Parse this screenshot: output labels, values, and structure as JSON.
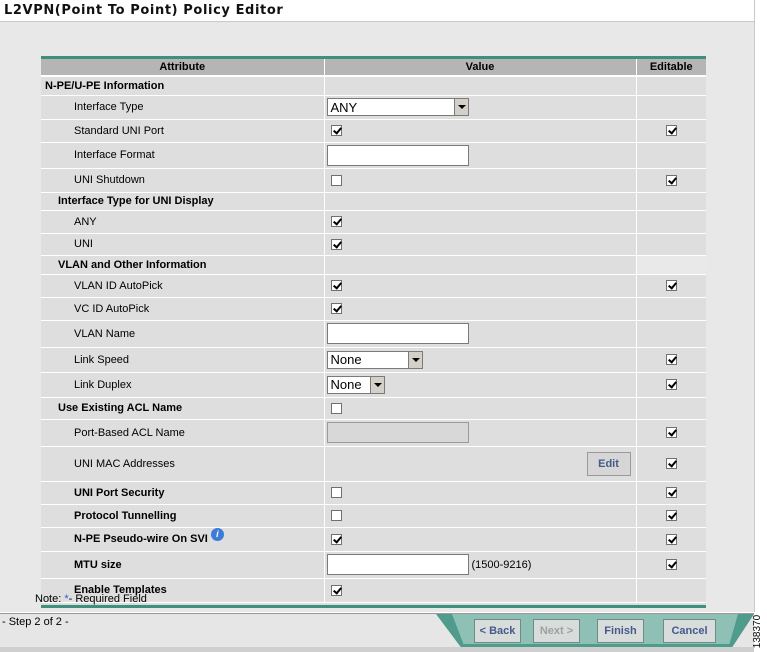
{
  "header": {
    "title": "L2VPN(Point To Point) Policy Editor"
  },
  "table": {
    "columns": {
      "attribute": "Attribute",
      "value": "Value",
      "editable": "Editable"
    },
    "rows": [
      {
        "label": "N-PE/U-PE Information"
      },
      {
        "label": "Interface Type",
        "select": "ANY",
        "editable": null
      },
      {
        "label": "Standard UNI Port",
        "checked": true,
        "editable": true
      },
      {
        "label": "Interface Format",
        "input": "",
        "editable": null
      },
      {
        "label": "UNI Shutdown",
        "checked": false,
        "editable": true
      },
      {
        "label": "Interface Type for UNI Display"
      },
      {
        "label": "ANY",
        "checked": true
      },
      {
        "label": "UNI",
        "checked": true
      },
      {
        "label": "VLAN and Other Information"
      },
      {
        "label": "VLAN ID AutoPick",
        "checked": true,
        "editable": true
      },
      {
        "label": "VC ID AutoPick",
        "checked": true
      },
      {
        "label": "VLAN Name",
        "input": ""
      },
      {
        "label": "Link Speed",
        "select": "None",
        "editable": true
      },
      {
        "label": "Link Duplex",
        "select": "None",
        "editable": true
      },
      {
        "label": "Use Existing ACL Name",
        "checked": false
      },
      {
        "label": "Port-Based ACL Name",
        "input": "",
        "editable": true
      },
      {
        "label": "UNI MAC Addresses",
        "button": "Edit",
        "editable": true
      },
      {
        "label": "UNI Port Security",
        "checked": false,
        "editable": true
      },
      {
        "label": "Protocol Tunnelling",
        "checked": false,
        "editable": true
      },
      {
        "label": "N-PE Pseudo-wire On SVI",
        "checked": true,
        "editable": true,
        "info_icon": "info-icon"
      },
      {
        "label": "MTU size",
        "input": "",
        "range": "(1500-9216)",
        "editable": true
      },
      {
        "label": "Enable Templates",
        "checked": true
      }
    ]
  },
  "note": {
    "prefix": "Note: ",
    "star": "*",
    "suffix": "- Required Field"
  },
  "footer": {
    "step": "- Step 2 of 2 -",
    "back": "< Back",
    "next": "Next >",
    "finish": "Finish",
    "cancel": "Cancel"
  },
  "figure_number": "138370"
}
